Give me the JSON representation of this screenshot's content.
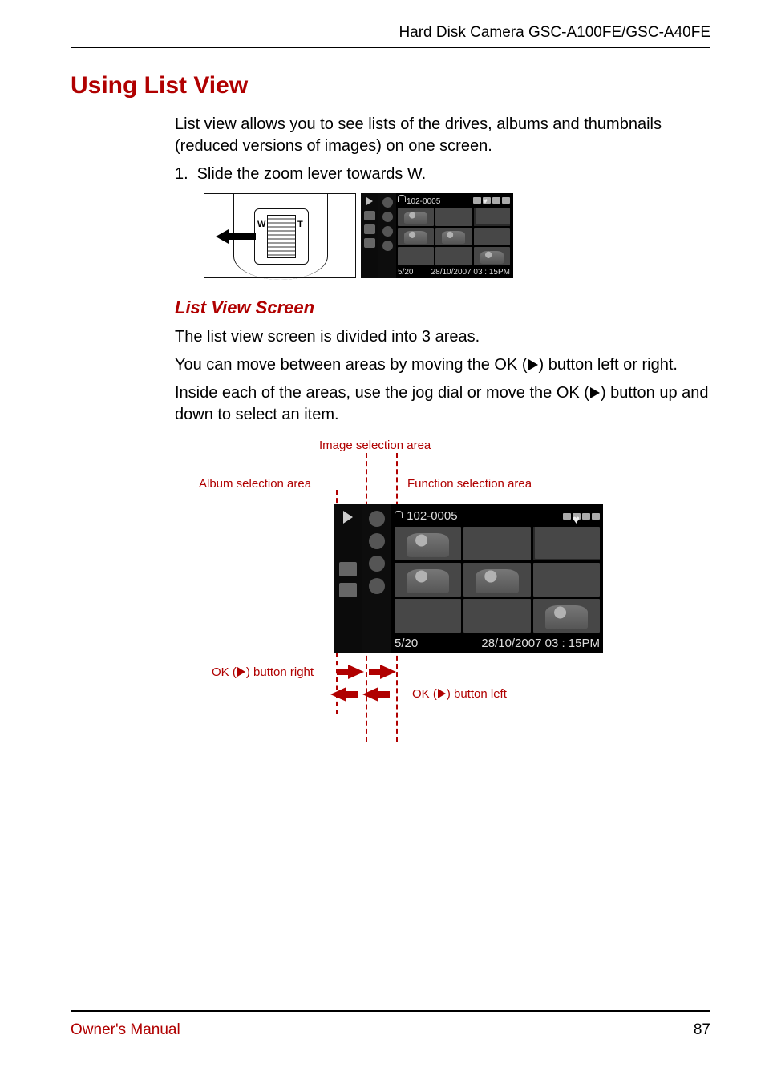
{
  "header": {
    "product": "Hard Disk Camera GSC-A100FE/GSC-A40FE"
  },
  "title": "Using List View",
  "intro": "List view allows you to see lists of the drives, albums and thumbnails (reduced versions of images) on one screen.",
  "step1_num": "1.",
  "step1_text": "Slide the zoom lever towards W.",
  "zoom_labels": {
    "w": "W",
    "t": "T"
  },
  "screenshot": {
    "folder": "102-0005",
    "counter": "5/20",
    "datetime": "28/10/2007 03 : 15PM"
  },
  "section_heading": "List View Screen",
  "p1": "The list view screen is divided into 3 areas.",
  "p2a": "You can move between areas by moving the OK (",
  "p2b": ") button left or right.",
  "p3a": "Inside each of the areas, use the jog dial or move the OK (",
  "p3b": ") button up and down to select an item.",
  "labels": {
    "image_area": "Image selection area",
    "album_area": "Album selection area",
    "function_area": "Function selection area",
    "ok_right_a": "OK (",
    "ok_right_b": ") button right",
    "ok_left_a": "OK (",
    "ok_left_b": ") button left"
  },
  "footer": {
    "owners": "Owner's Manual",
    "page": "87"
  }
}
